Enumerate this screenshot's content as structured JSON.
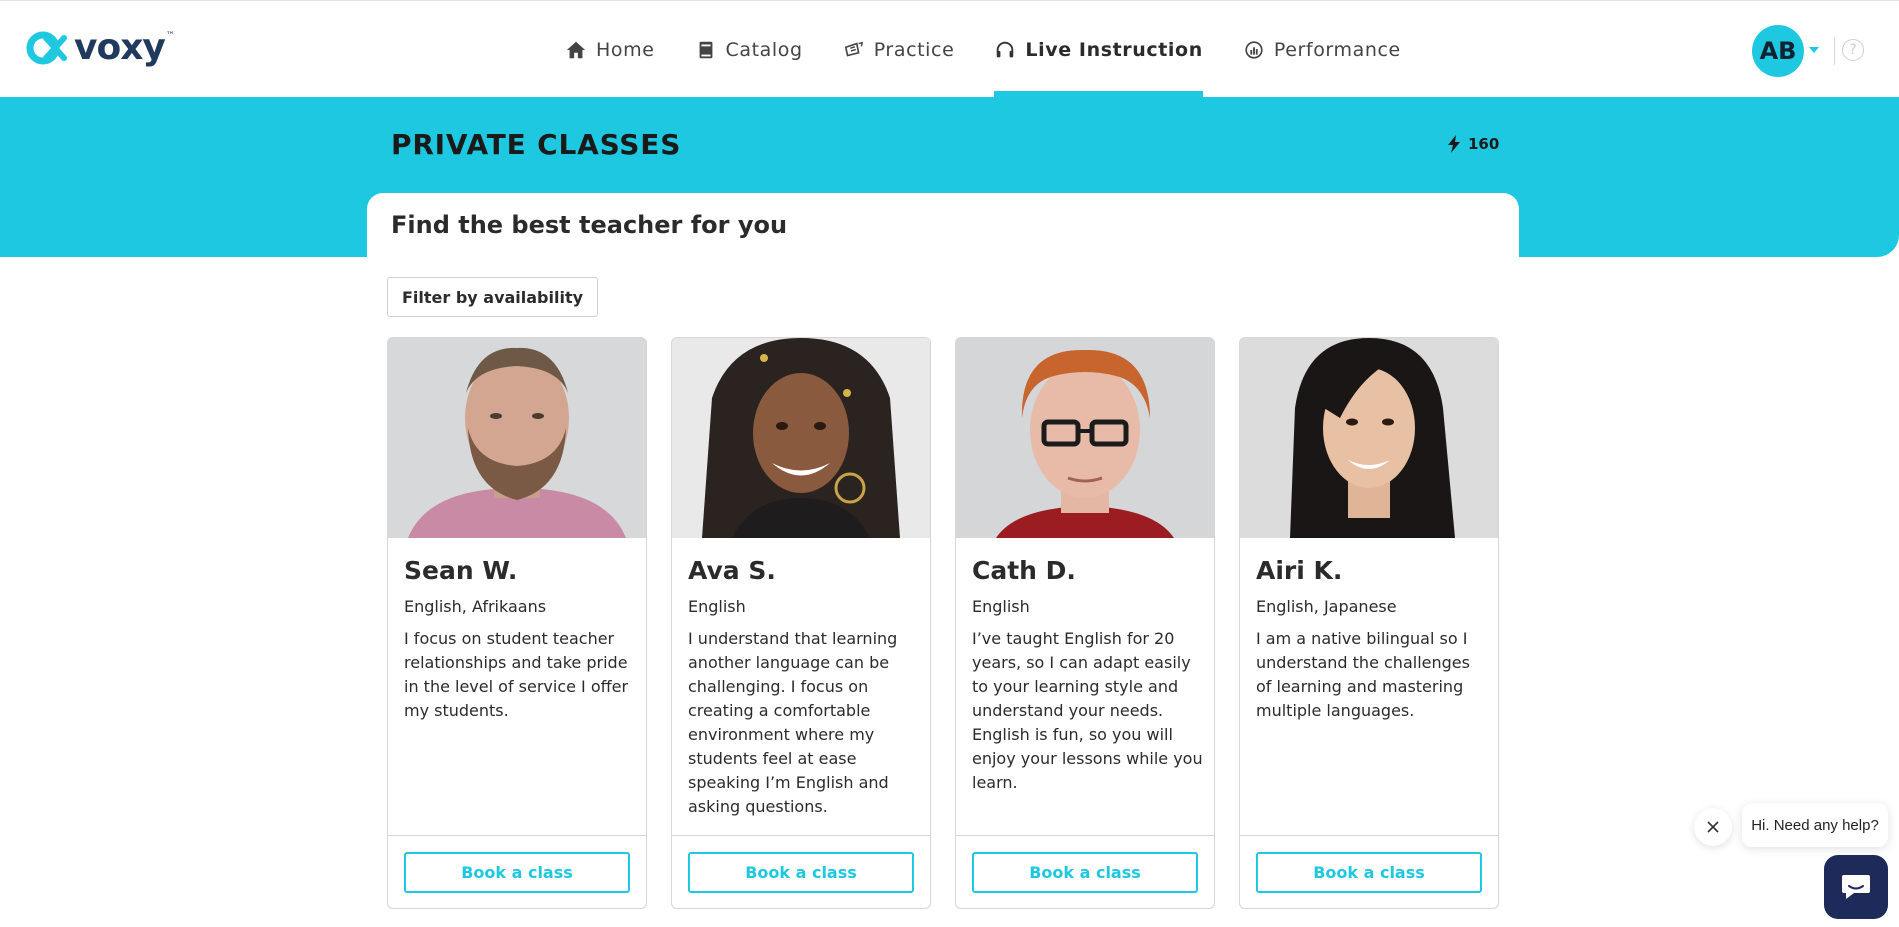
{
  "brand": {
    "name": "voxy",
    "accent": "#1ec8e0",
    "dark": "#1f3a5f"
  },
  "nav": {
    "items": [
      {
        "label": "Home",
        "icon": "home-icon"
      },
      {
        "label": "Catalog",
        "icon": "book-icon"
      },
      {
        "label": "Practice",
        "icon": "practice-icon"
      },
      {
        "label": "Live Instruction",
        "icon": "headset-icon",
        "active": true
      },
      {
        "label": "Performance",
        "icon": "performance-icon"
      }
    ]
  },
  "user": {
    "initials": "AB"
  },
  "help": {
    "glyph": "?"
  },
  "page": {
    "title": "PRIVATE CLASSES",
    "credits": "160",
    "subtitle": "Find the best teacher for you",
    "filter_label": "Filter by availability"
  },
  "teachers": [
    {
      "name": "Sean W.",
      "languages": "English, Afrikaans",
      "description": "I focus on student teacher relationships and take pride in the level of service I offer my students.",
      "button": "Book a class"
    },
    {
      "name": "Ava S.",
      "languages": "English",
      "description": "I understand that learning another language can be challenging. I focus on creating a comfortable environment where my students feel at ease speaking I’m English and asking questions.",
      "button": "Book a class"
    },
    {
      "name": "Cath D.",
      "languages": "English",
      "description": "I’ve taught English for 20 years, so I can adapt easily to your learning style and understand your needs. English is fun, so you will enjoy your lessons while you learn.",
      "button": "Book a class"
    },
    {
      "name": "Airi K.",
      "languages": "English, Japanese",
      "description": "I am a native bilingual so I understand the challenges of learning and mastering multiple languages.",
      "button": "Book a class"
    }
  ],
  "chat": {
    "prompt": "Hi. Need any help?"
  }
}
